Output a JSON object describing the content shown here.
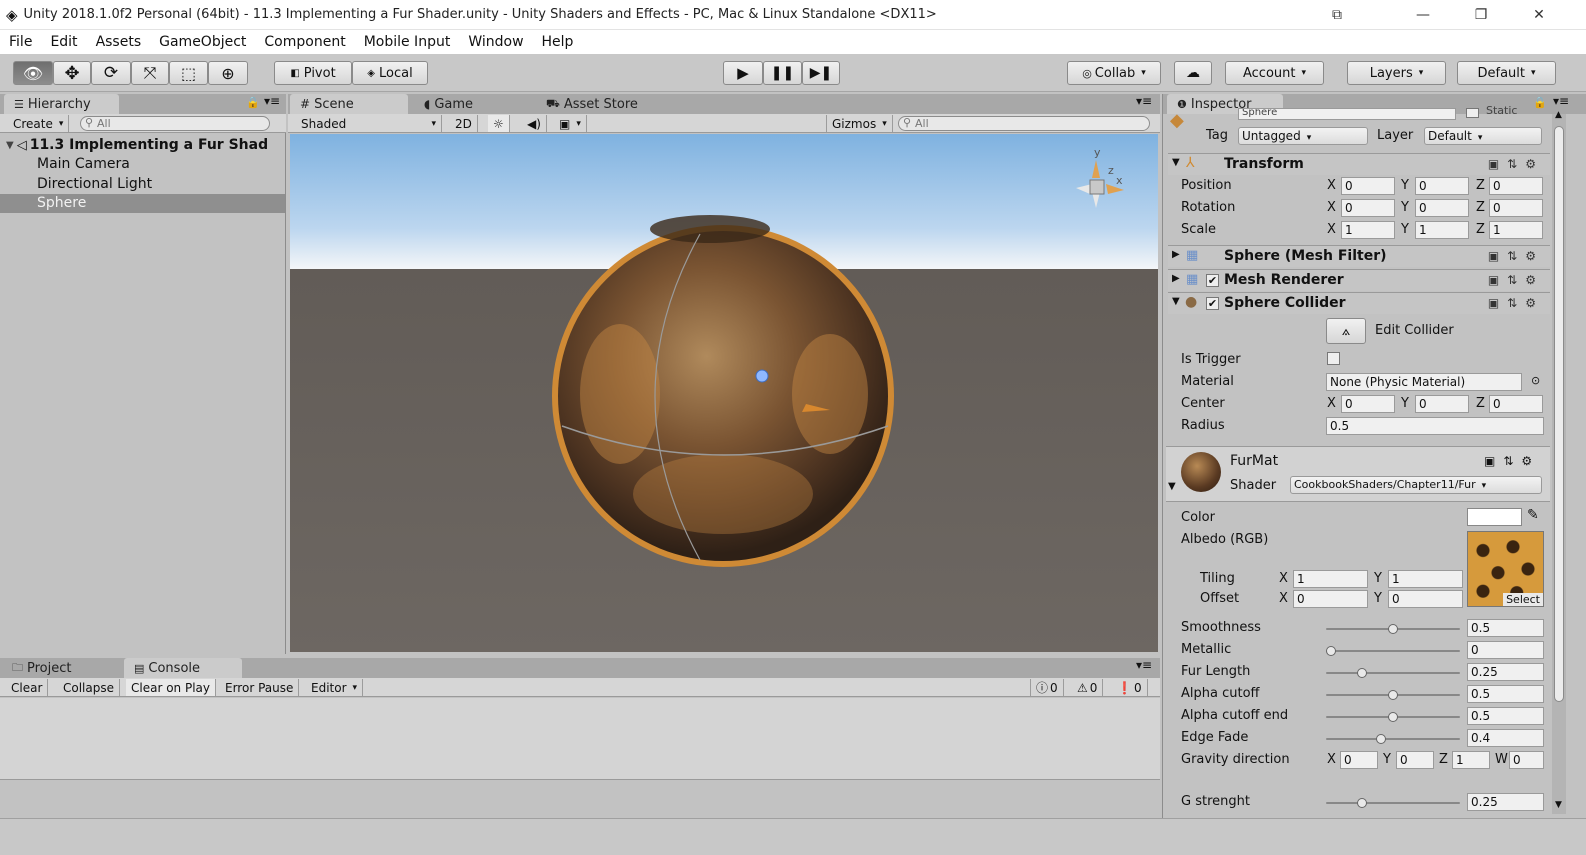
{
  "window": {
    "title": "Unity 2018.1.0f2 Personal (64bit) - 11.3 Implementing a Fur Shader.unity - Unity Shaders and Effects - PC, Mac & Linux Standalone <DX11>",
    "icons": {
      "unity": "unity-logo-icon",
      "restore": "restore-icon",
      "minimize": "minimize-icon",
      "maximize": "maximize-icon",
      "close": "close-icon"
    }
  },
  "menu": [
    "File",
    "Edit",
    "Assets",
    "GameObject",
    "Component",
    "Mobile Input",
    "Window",
    "Help"
  ],
  "toolbar": {
    "pivot": "Pivot",
    "local": "Local",
    "collab": "Collab",
    "account": "Account",
    "layers": "Layers",
    "layout": "Default"
  },
  "hierarchy": {
    "tab": "Hierarchy",
    "create": "Create",
    "search_placeholder": "All",
    "scene": "11.3 Implementing a Fur Shad",
    "items": [
      "Main Camera",
      "Directional Light",
      "Sphere"
    ],
    "selected": "Sphere"
  },
  "scene": {
    "tabs": [
      "Scene",
      "Game",
      "Asset Store"
    ],
    "shading": "Shaded",
    "mode2d": "2D",
    "gizmos": "Gizmos",
    "search_placeholder": "All",
    "gizmo_axes": {
      "y": "y",
      "x": "x",
      "z": "z"
    },
    "colors": {
      "sky": "#9fc7ea",
      "ground": "#6b655f",
      "fur": "#cf8a35",
      "fur_dark": "#3b2a19"
    }
  },
  "console": {
    "tabs": [
      "Project",
      "Console"
    ],
    "buttons": [
      "Clear",
      "Collapse",
      "Clear on Play",
      "Error Pause",
      "Editor"
    ],
    "counts": {
      "info": "0",
      "warn": "0",
      "error": "0"
    }
  },
  "inspector": {
    "tab": "Inspector",
    "object_name": "Sphere",
    "static": "Static",
    "tag_label": "Tag",
    "tag": "Untagged",
    "layer_label": "Layer",
    "layer": "Default",
    "transform": {
      "title": "Transform",
      "rows": [
        {
          "label": "Position",
          "x": "0",
          "y": "0",
          "z": "0"
        },
        {
          "label": "Rotation",
          "x": "0",
          "y": "0",
          "z": "0"
        },
        {
          "label": "Scale",
          "x": "1",
          "y": "1",
          "z": "1"
        }
      ]
    },
    "mesh_filter": "Sphere (Mesh Filter)",
    "mesh_renderer": "Mesh Renderer",
    "sphere_collider": {
      "title": "Sphere Collider",
      "edit_collider": "Edit Collider",
      "is_trigger_label": "Is Trigger",
      "material_label": "Material",
      "material": "None (Physic Material)",
      "center_label": "Center",
      "center": {
        "x": "0",
        "y": "0",
        "z": "0"
      },
      "radius_label": "Radius",
      "radius": "0.5"
    },
    "material": {
      "name": "FurMat",
      "shader_label": "Shader",
      "shader": "CookbookShaders/Chapter11/Fur",
      "color_label": "Color",
      "albedo_label": "Albedo (RGB)",
      "tiling_label": "Tiling",
      "tiling": {
        "x": "1",
        "y": "1"
      },
      "offset_label": "Offset",
      "offset": {
        "x": "0",
        "y": "0"
      },
      "select": "Select",
      "sliders": [
        {
          "label": "Smoothness",
          "value": "0.5",
          "fraction": 0.5
        },
        {
          "label": "Metallic",
          "value": "0",
          "fraction": 0.0
        },
        {
          "label": "Fur Length",
          "value": "0.25",
          "fraction": 0.25
        },
        {
          "label": "Alpha cutoff",
          "value": "0.5",
          "fraction": 0.5
        },
        {
          "label": "Alpha cutoff end",
          "value": "0.5",
          "fraction": 0.5
        },
        {
          "label": "Edge Fade",
          "value": "0.4",
          "fraction": 0.4
        }
      ],
      "gravity_label": "Gravity direction",
      "gravity": {
        "x": "0",
        "y": "0",
        "z": "1",
        "w": "0"
      },
      "g_strength_label": "G strenght",
      "g_strength": {
        "value": "0.25",
        "fraction": 0.25
      }
    }
  }
}
